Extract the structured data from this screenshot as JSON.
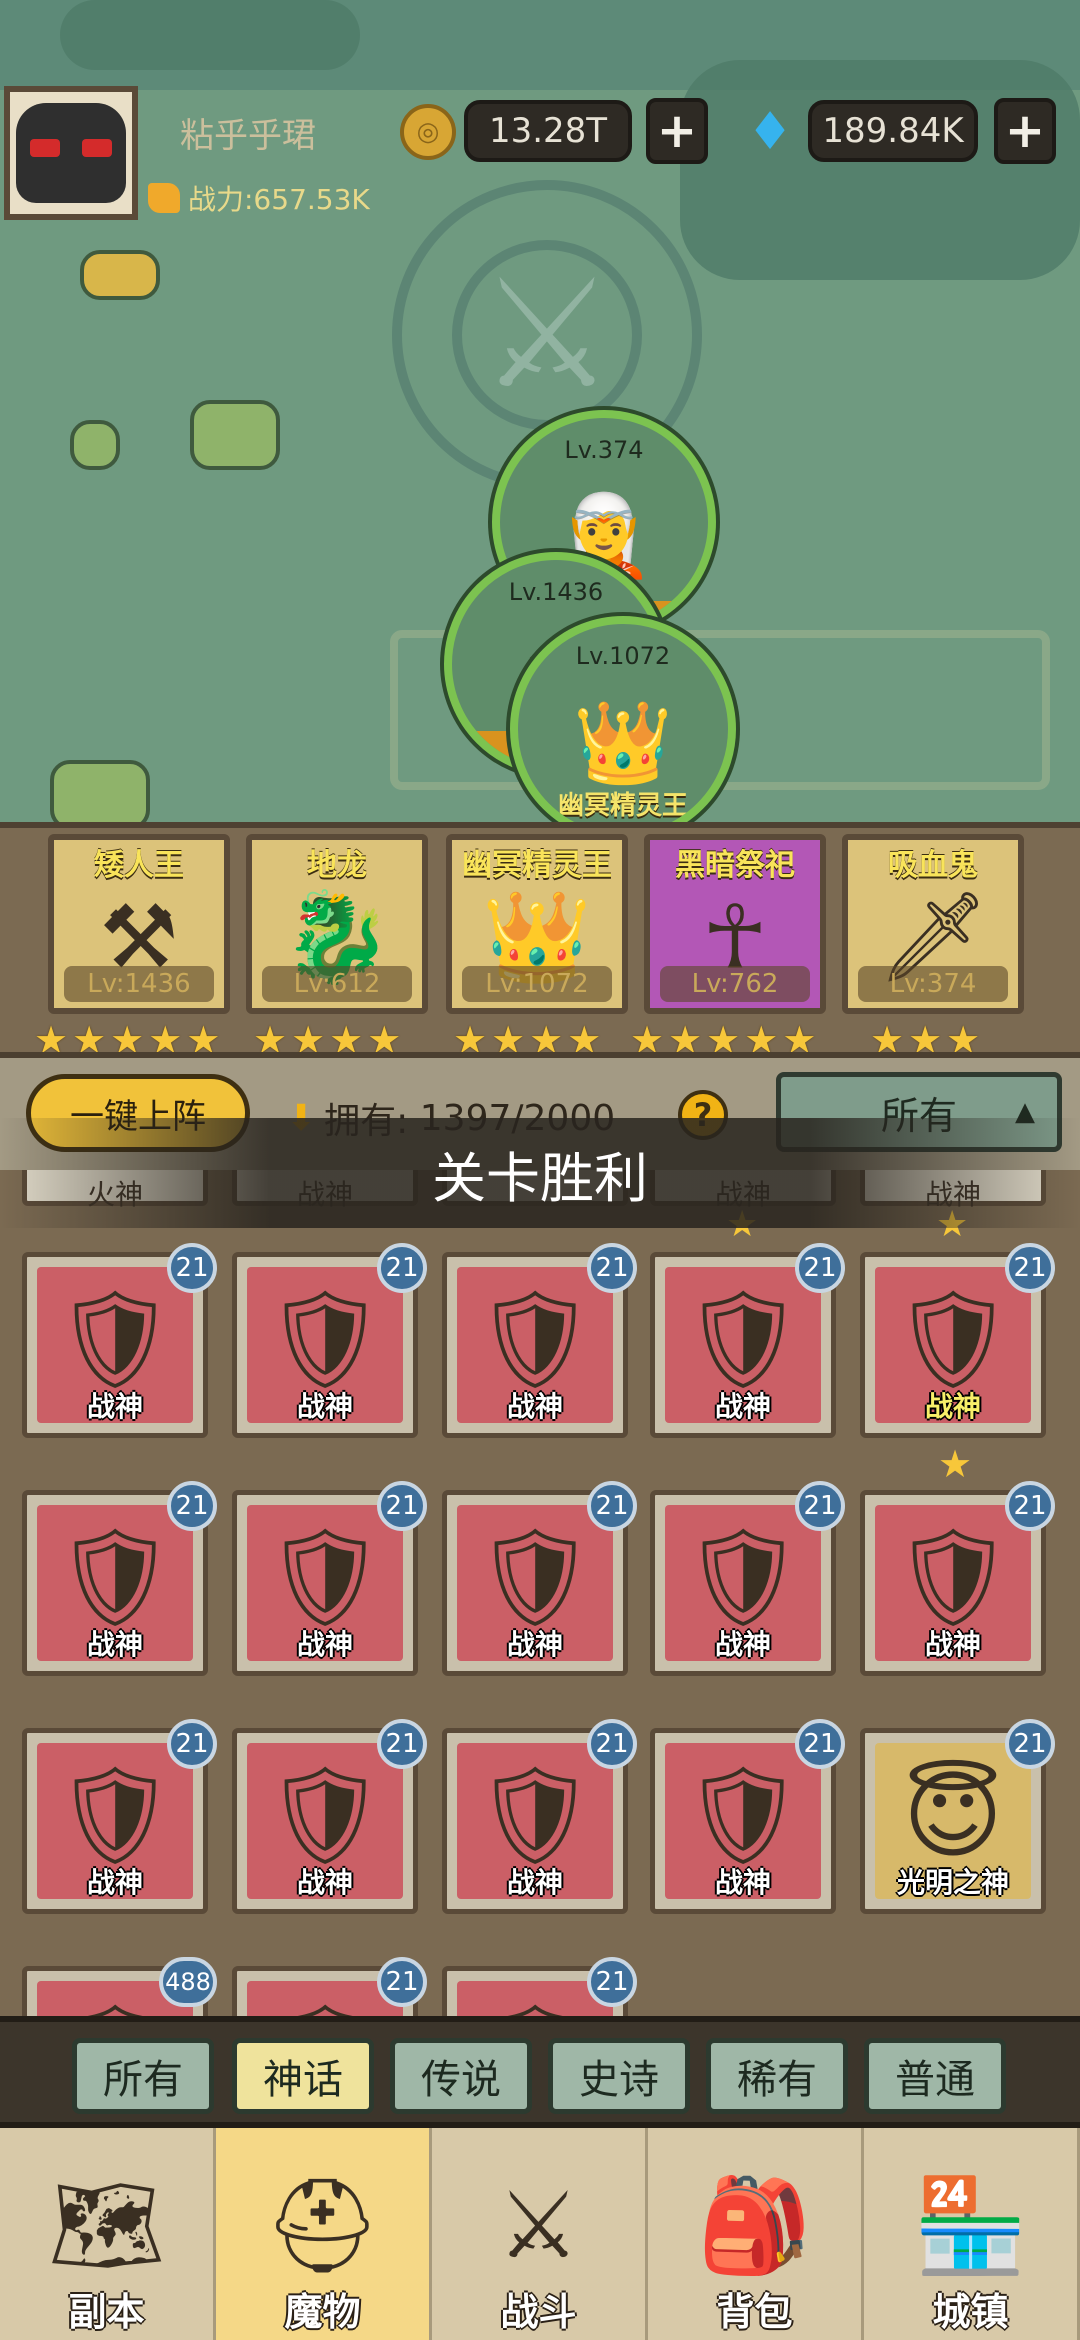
{
  "player": {
    "name": "粘乎乎珺",
    "power_label": "战力:657.53K",
    "gold": "13.28T",
    "gems": "189.84K",
    "add_symbol": "+"
  },
  "map_bubbles": [
    {
      "level": "Lv.374",
      "icon": "vampire-girl-icon",
      "fill": 0.12
    },
    {
      "level": "Lv.1436",
      "icon": "dwarf-king-icon",
      "fill": 0.18
    },
    {
      "level": "Lv.1072",
      "icon": "elf-king-icon",
      "name": "幽冥精灵王"
    }
  ],
  "team": [
    {
      "name": "矮人王",
      "level": "Lv:1436",
      "stars": 5,
      "bg": "#dcc37a",
      "icon": "dwarf-king-icon"
    },
    {
      "name": "地龙",
      "level": "Lv:612",
      "stars": 4,
      "bg": "#dcc37a",
      "icon": "earth-dragon-icon"
    },
    {
      "name": "幽冥精灵王",
      "level": "Lv:1072",
      "stars": 4,
      "bg": "#dcc37a",
      "icon": "elf-king-icon"
    },
    {
      "name": "黑暗祭祀",
      "level": "Lv:762",
      "stars": 5,
      "bg": "#b357b6",
      "icon": "dark-priest-icon"
    },
    {
      "name": "吸血鬼",
      "level": "Lv:374",
      "stars": 3,
      "bg": "#dcc37a",
      "icon": "vampire-icon"
    }
  ],
  "toolbar": {
    "auto_button": "一键上阵",
    "own_label": "拥有:",
    "own_count": "1397/2000",
    "help": "?",
    "filter": "所有"
  },
  "banner": "关卡胜利",
  "peek_row": [
    "火神",
    "战神",
    "",
    "战神",
    "战神"
  ],
  "grid": [
    {
      "name": "战神",
      "badge": "21"
    },
    {
      "name": "战神",
      "badge": "21"
    },
    {
      "name": "战神",
      "badge": "21"
    },
    {
      "name": "战神",
      "badge": "21"
    },
    {
      "name": "战神",
      "badge": "21",
      "highlight": true
    },
    {
      "name": "战神",
      "badge": "21"
    },
    {
      "name": "战神",
      "badge": "21"
    },
    {
      "name": "战神",
      "badge": "21"
    },
    {
      "name": "战神",
      "badge": "21"
    },
    {
      "name": "战神",
      "badge": "21"
    },
    {
      "name": "战神",
      "badge": "21"
    },
    {
      "name": "战神",
      "badge": "21"
    },
    {
      "name": "战神",
      "badge": "21"
    },
    {
      "name": "战神",
      "badge": "21"
    },
    {
      "name": "光明之神",
      "badge": "21",
      "gold": true
    },
    {
      "name": "",
      "badge": "488"
    },
    {
      "name": "",
      "badge": "21"
    },
    {
      "name": "",
      "badge": "21"
    }
  ],
  "rarity_tabs": [
    "所有",
    "神话",
    "传说",
    "史诗",
    "稀有",
    "普通"
  ],
  "rarity_active": 1,
  "nav": [
    {
      "label": "副本",
      "icon": "map-scroll-icon"
    },
    {
      "label": "魔物",
      "icon": "helmet-icon",
      "active": true
    },
    {
      "label": "战斗",
      "icon": "crossed-swords-icon"
    },
    {
      "label": "背包",
      "icon": "backpack-icon"
    },
    {
      "label": "城镇",
      "icon": "shop-icon"
    }
  ]
}
